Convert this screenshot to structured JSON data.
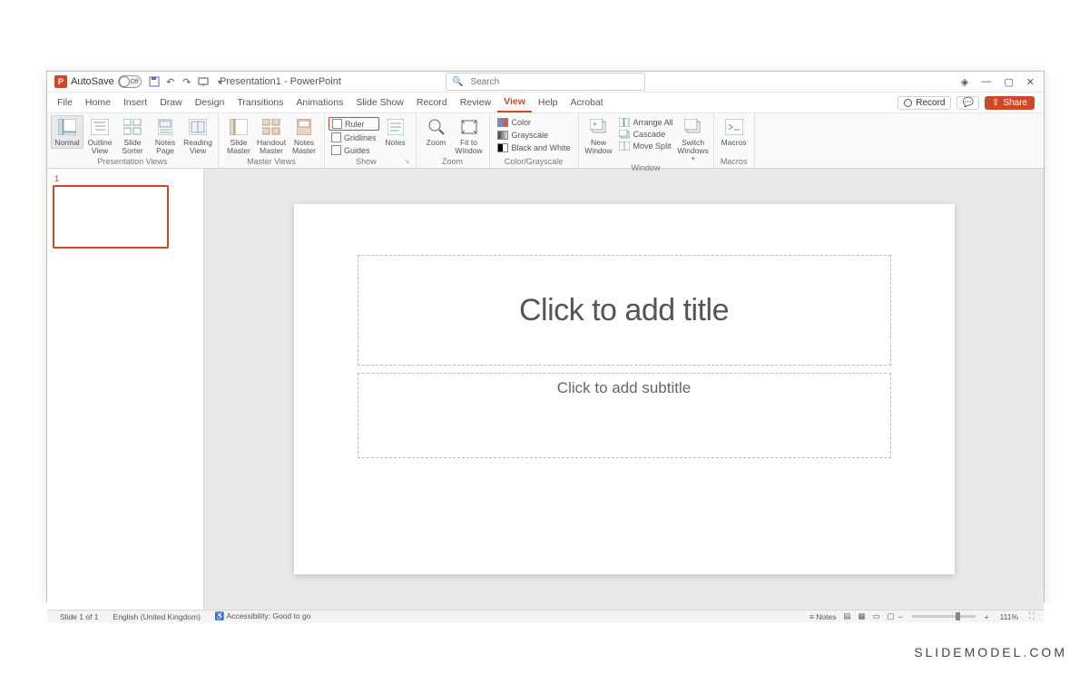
{
  "titlebar": {
    "autosave_label": "AutoSave",
    "toggle_text": "Off",
    "doc_title": "Presentation1 - PowerPoint",
    "search_placeholder": "Search"
  },
  "tabs": {
    "items": [
      "File",
      "Home",
      "Insert",
      "Draw",
      "Design",
      "Transitions",
      "Animations",
      "Slide Show",
      "Record",
      "Review",
      "View",
      "Help",
      "Acrobat"
    ],
    "active": "View",
    "record_label": "Record",
    "share_label": "Share"
  },
  "ribbon": {
    "presentation_views": {
      "label": "Presentation Views",
      "normal": "Normal",
      "outline": "Outline\nView",
      "sorter": "Slide\nSorter",
      "notes": "Notes\nPage",
      "reading": "Reading\nView"
    },
    "master_views": {
      "label": "Master Views",
      "slide": "Slide\nMaster",
      "handout": "Handout\nMaster",
      "notes": "Notes\nMaster"
    },
    "show": {
      "label": "Show",
      "ruler": "Ruler",
      "gridlines": "Gridlines",
      "guides": "Guides",
      "notes": "Notes"
    },
    "zoom": {
      "label": "Zoom",
      "zoom": "Zoom",
      "fit": "Fit to\nWindow"
    },
    "color": {
      "label": "Color/Grayscale",
      "color": "Color",
      "grayscale": "Grayscale",
      "bw": "Black and White"
    },
    "window": {
      "label": "Window",
      "new": "New\nWindow",
      "arrange": "Arrange All",
      "cascade": "Cascade",
      "split": "Move Split",
      "switch": "Switch\nWindows"
    },
    "macros": {
      "label": "Macros",
      "macros": "Macros"
    }
  },
  "slide": {
    "thumb_number": "1",
    "title_placeholder": "Click to add title",
    "subtitle_placeholder": "Click to add subtitle"
  },
  "statusbar": {
    "slide_count": "Slide 1 of 1",
    "language": "English (United Kingdom)",
    "accessibility": "Accessibility: Good to go",
    "notes": "Notes",
    "zoom_pct": "111%"
  },
  "watermark": "SLIDEMODEL.COM"
}
